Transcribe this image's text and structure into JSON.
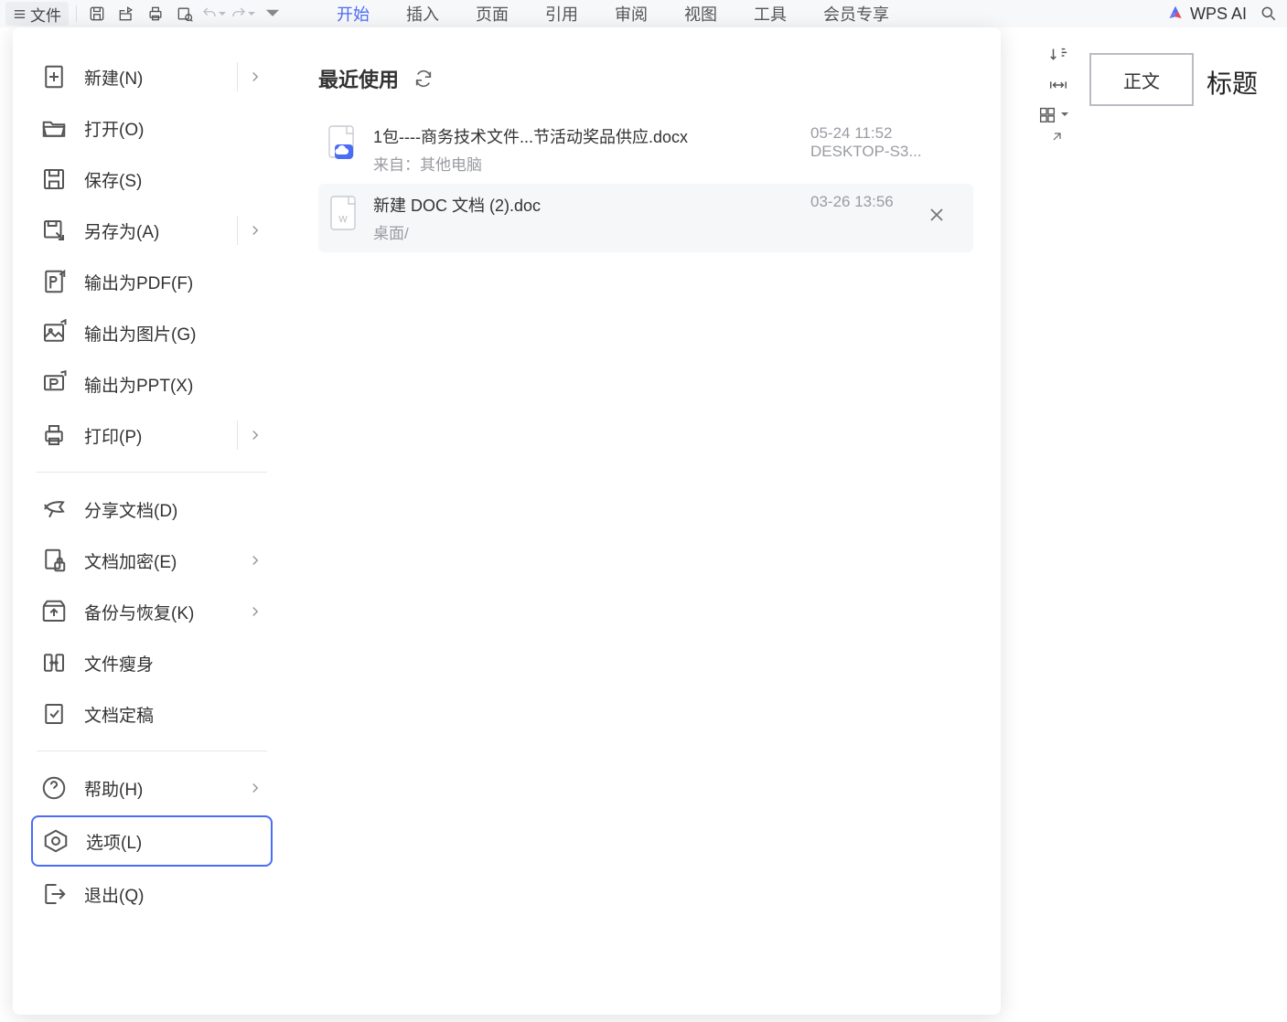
{
  "topbar": {
    "file_label": "文件",
    "wps_ai": "WPS AI"
  },
  "tabs": [
    "开始",
    "插入",
    "页面",
    "引用",
    "审阅",
    "视图",
    "工具",
    "会员专享"
  ],
  "active_tab": 0,
  "right_ribbon": {
    "style_box": "正文",
    "title_label": "标题"
  },
  "sidebar": {
    "groups": [
      [
        {
          "k": "new",
          "label": "新建(N)",
          "chev": true
        },
        {
          "k": "open",
          "label": "打开(O)"
        },
        {
          "k": "save",
          "label": "保存(S)"
        },
        {
          "k": "saveas",
          "label": "另存为(A)",
          "chev": true
        },
        {
          "k": "pdf",
          "label": "输出为PDF(F)"
        },
        {
          "k": "img",
          "label": "输出为图片(G)"
        },
        {
          "k": "ppt",
          "label": "输出为PPT(X)"
        },
        {
          "k": "print",
          "label": "打印(P)",
          "chev": true
        }
      ],
      [
        {
          "k": "share",
          "label": "分享文档(D)"
        },
        {
          "k": "encrypt",
          "label": "文档加密(E)",
          "chev": true
        },
        {
          "k": "backup",
          "label": "备份与恢复(K)",
          "chev": true
        },
        {
          "k": "slim",
          "label": "文件瘦身"
        },
        {
          "k": "final",
          "label": "文档定稿"
        }
      ],
      [
        {
          "k": "help",
          "label": "帮助(H)",
          "chev": true
        },
        {
          "k": "options",
          "label": "选项(L)",
          "selected": true
        },
        {
          "k": "exit",
          "label": "退出(Q)"
        }
      ]
    ]
  },
  "recent": {
    "title": "最近使用",
    "files": [
      {
        "name": "1包----商务技术文件...节活动奖品供应.docx",
        "src": "来自：其他电脑",
        "date": "05-24 11:52",
        "device": "DESKTOP-S3...",
        "icon": "doc-cloud"
      },
      {
        "name": "新建 DOC 文档 (2).doc",
        "src": "桌面/",
        "date": "03-26 13:56",
        "device": "",
        "icon": "doc",
        "closable": true,
        "hover": true
      }
    ]
  }
}
